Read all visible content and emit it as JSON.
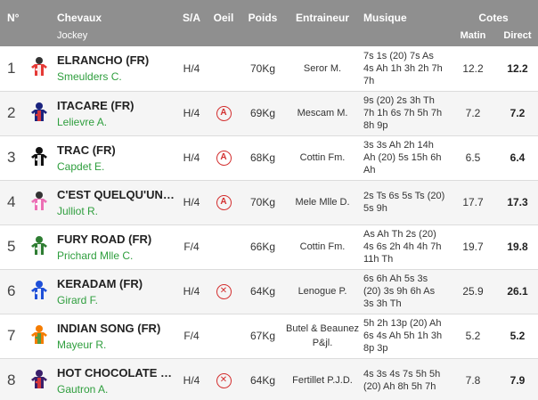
{
  "header": {
    "num": "N°",
    "horse": "Chevaux",
    "jockey": "Jockey",
    "sa": "S/A",
    "oeil": "Oeil",
    "poids": "Poids",
    "entraineur": "Entraineur",
    "musique": "Musique",
    "cotes": "Cotes",
    "matin": "Matin",
    "direct": "Direct"
  },
  "colors": {
    "header_bg": "#8f8f8f",
    "jockey_green": "#2e9e3d",
    "oeil_red": "#d32f2f"
  },
  "runners": [
    {
      "num": "1",
      "silk_icon": "silk-red-white-icon",
      "silk": [
        "#e53935",
        "#ffffff",
        "#333333"
      ],
      "horse": "ELRANCHO (FR)",
      "jockey": "Smeulders C.",
      "sa": "H/4",
      "oeil": "",
      "poids": "70Kg",
      "entraineur": "Seror M.",
      "musique": "7s 1s (20) 7s As 4s Ah 1h 3h 2h 7h 7h",
      "matin": "12.2",
      "direct": "12.2"
    },
    {
      "num": "2",
      "silk_icon": "silk-navy-red-icon",
      "silk": [
        "#1a237e",
        "#e53935",
        "#1a237e"
      ],
      "horse": "ITACARE (FR)",
      "jockey": "Lelievre A.",
      "sa": "H/4",
      "oeil": "A",
      "poids": "69Kg",
      "entraineur": "Mescam M.",
      "musique": "9s (20) 2s 3h Th 7h 1h 6s 7h 5h 7h 8h 9p",
      "matin": "7.2",
      "direct": "7.2"
    },
    {
      "num": "3",
      "silk_icon": "silk-black-white-icon",
      "silk": [
        "#111111",
        "#ffffff",
        "#111111"
      ],
      "horse": "TRAC (FR)",
      "jockey": "Capdet E.",
      "sa": "H/4",
      "oeil": "A",
      "poids": "68Kg",
      "entraineur": "Cottin Fm.",
      "musique": "3s 3s Ah 2h 14h Ah (20) 5s 15h 6h Ah",
      "matin": "6.5",
      "direct": "6.4"
    },
    {
      "num": "4",
      "silk_icon": "silk-pink-white-icon",
      "silk": [
        "#ec6fb5",
        "#ffffff",
        "#333333"
      ],
      "horse": "C'EST QUELQU'UN (FR)",
      "jockey": "Julliot R.",
      "sa": "H/4",
      "oeil": "A",
      "poids": "70Kg",
      "entraineur": "Mele Mlle D.",
      "musique": "2s Ts 6s 5s Ts (20) 5s 9h",
      "matin": "17.7",
      "direct": "17.3"
    },
    {
      "num": "5",
      "silk_icon": "silk-green-white-icon",
      "silk": [
        "#2e7d32",
        "#ffffff",
        "#2e7d32"
      ],
      "horse": "FURY ROAD (FR)",
      "jockey": "Prichard Mlle C.",
      "sa": "F/4",
      "oeil": "",
      "poids": "66Kg",
      "entraineur": "Cottin Fm.",
      "musique": "As Ah Th 2s (20) 4s 6s 2h 4h 4h 7h 11h Th",
      "matin": "19.7",
      "direct": "19.8"
    },
    {
      "num": "6",
      "silk_icon": "silk-blue-white-icon",
      "silk": [
        "#1e4fd8",
        "#ffffff",
        "#1e4fd8"
      ],
      "horse": "KERADAM (FR)",
      "jockey": "Girard F.",
      "sa": "H/4",
      "oeil": "X",
      "poids": "64Kg",
      "entraineur": "Lenogue P.",
      "musique": "6s 6h Ah 5s 3s (20) 3s 9h 6h As 3s 3h Th",
      "matin": "25.9",
      "direct": "26.1"
    },
    {
      "num": "7",
      "silk_icon": "silk-orange-green-icon",
      "silk": [
        "#f57c00",
        "#43a047",
        "#f57c00"
      ],
      "horse": "INDIAN SONG (FR)",
      "jockey": "Mayeur R.",
      "sa": "F/4",
      "oeil": "",
      "poids": "67Kg",
      "entraineur": "Butel & Beaunez P&jl.",
      "musique": "5h 2h 13p (20) Ah 6s 4s Ah 5h 1h 3h 8p 3p",
      "matin": "5.2",
      "direct": "5.2"
    },
    {
      "num": "8",
      "silk_icon": "silk-purple-red-icon",
      "silk": [
        "#3a1f6b",
        "#e53935",
        "#3a1f6b"
      ],
      "horse": "HOT CHOCOLATE (FR)",
      "jockey": "Gautron A.",
      "sa": "H/4",
      "oeil": "X",
      "poids": "64Kg",
      "entraineur": "Fertillet P.J.D.",
      "musique": "4s 3s 4s 7s 5h 5h (20) Ah 8h 5h 7h",
      "matin": "7.8",
      "direct": "7.9"
    }
  ]
}
